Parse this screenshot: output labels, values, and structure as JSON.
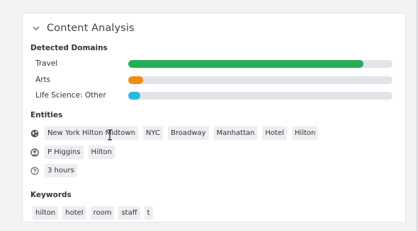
{
  "panel": {
    "title": "Content Analysis"
  },
  "domains": {
    "label": "Detected Domains",
    "items": [
      {
        "name": "Travel",
        "value": 0.89,
        "color": "#27ae55"
      },
      {
        "name": "Arts",
        "value": 0.055,
        "color": "#f28c0f"
      },
      {
        "name": "Life Science: Other",
        "value": 0.045,
        "color": "#2bb8df"
      }
    ]
  },
  "entities": {
    "label": "Entities",
    "rows": [
      {
        "icon": "globe-icon",
        "chips": [
          "New York Hilton Midtown",
          "NYC",
          "Broadway",
          "Manhattan",
          "Hotel",
          "Hilton"
        ]
      },
      {
        "icon": "user-circle-icon",
        "chips": [
          "P Higgins",
          "Hilton"
        ]
      },
      {
        "icon": "question-circle-icon",
        "chips": [
          "3 hours"
        ]
      }
    ]
  },
  "keywords": {
    "label": "Keywords",
    "chips": [
      "hilton",
      "hotel",
      "room",
      "staff",
      "t"
    ]
  }
}
